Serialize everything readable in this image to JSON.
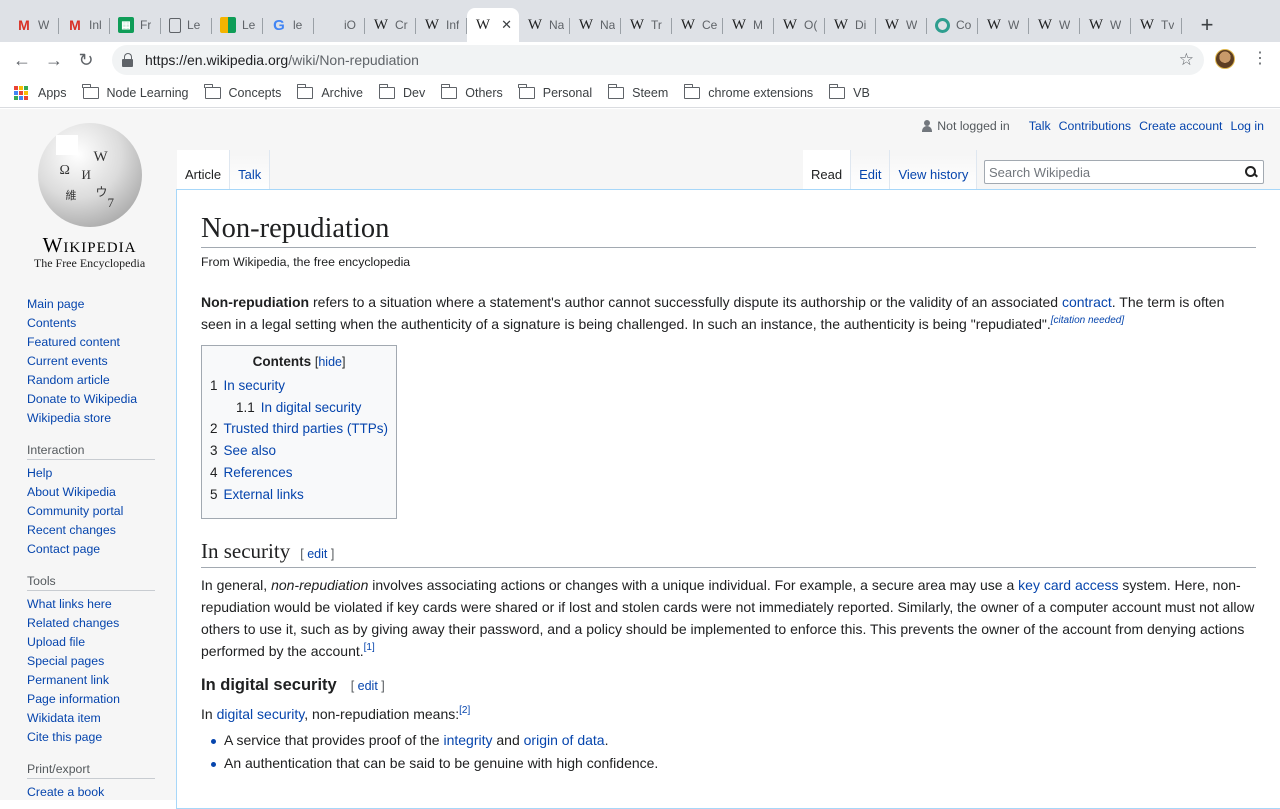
{
  "browser": {
    "tabs": [
      {
        "icon": "gmail-icon",
        "glyph": "M",
        "title": "W"
      },
      {
        "icon": "gmail-icon",
        "glyph": "M",
        "title": "Inl"
      },
      {
        "icon": "sheets-icon",
        "glyph": "▦",
        "title": "Fr"
      },
      {
        "icon": "document-icon",
        "glyph": "",
        "title": "Le"
      },
      {
        "icon": "slides-icon",
        "glyph": "",
        "title": "Le"
      },
      {
        "icon": "google-icon",
        "glyph": "G",
        "title": "le"
      },
      {
        "icon": "apple-icon",
        "glyph": "",
        "title": "iO"
      },
      {
        "icon": "wikipedia-icon",
        "glyph": "W",
        "title": "Cr"
      },
      {
        "icon": "wikipedia-icon",
        "glyph": "W",
        "title": "Inf"
      },
      {
        "icon": "wikipedia-icon",
        "glyph": "W",
        "title": "",
        "active": true
      },
      {
        "icon": "wikipedia-icon",
        "glyph": "W",
        "title": "Na"
      },
      {
        "icon": "wikipedia-icon",
        "glyph": "W",
        "title": "Na"
      },
      {
        "icon": "wikipedia-icon",
        "glyph": "W",
        "title": "Tr"
      },
      {
        "icon": "wikipedia-icon",
        "glyph": "W",
        "title": "Ce"
      },
      {
        "icon": "wikipedia-icon",
        "glyph": "W",
        "title": "M"
      },
      {
        "icon": "wikipedia-icon",
        "glyph": "W",
        "title": "O("
      },
      {
        "icon": "wikipedia-icon",
        "glyph": "W",
        "title": "Di"
      },
      {
        "icon": "wikipedia-icon",
        "glyph": "W",
        "title": "W"
      },
      {
        "icon": "globe-icon",
        "glyph": "",
        "title": "Co"
      },
      {
        "icon": "wikipedia-icon",
        "glyph": "W",
        "title": "W"
      },
      {
        "icon": "wikipedia-icon",
        "glyph": "W",
        "title": "W"
      },
      {
        "icon": "wikipedia-icon",
        "glyph": "W",
        "title": "W"
      },
      {
        "icon": "wikipedia-icon",
        "glyph": "W",
        "title": "Tv"
      }
    ],
    "close_glyph": "✕",
    "new_tab_glyph": "+",
    "back_glyph": "←",
    "forward_glyph": "→",
    "reload_glyph": "↻",
    "star_glyph": "☆",
    "menu_glyph": "⋮",
    "url_prefix": "https://en.wikipedia.org",
    "url_path": "/wiki/Non-repudiation",
    "bookmarks": [
      {
        "label": "Apps",
        "icon": "apps-grid-icon"
      },
      {
        "label": "Node Learning",
        "icon": "folder-icon"
      },
      {
        "label": "Concepts",
        "icon": "folder-icon"
      },
      {
        "label": "Archive",
        "icon": "folder-icon"
      },
      {
        "label": "Dev",
        "icon": "folder-icon"
      },
      {
        "label": "Others",
        "icon": "folder-icon"
      },
      {
        "label": "Personal",
        "icon": "folder-icon"
      },
      {
        "label": "Steem",
        "icon": "folder-icon"
      },
      {
        "label": "chrome extensions",
        "icon": "folder-icon"
      },
      {
        "label": "VB",
        "icon": "folder-icon"
      }
    ],
    "apps_colors": [
      "#ea4335",
      "#fbbc04",
      "#34a853",
      "#4285f4",
      "#ea4335",
      "#fbbc04",
      "#34a853",
      "#4285f4",
      "#ea4335"
    ]
  },
  "wiki": {
    "wordmark": "Wikipedia",
    "tagline": "The Free Encyclopedia",
    "globe_glyphs": [
      "Ω",
      "W",
      "И",
      "維",
      "ウ",
      "7"
    ],
    "personal": {
      "not_logged_in": "Not logged in",
      "links": [
        "Talk",
        "Contributions",
        "Create account",
        "Log in"
      ]
    },
    "namespaces": [
      "Article",
      "Talk"
    ],
    "views": [
      "Read",
      "Edit",
      "View history"
    ],
    "search_placeholder": "Search Wikipedia",
    "nav_main": [
      "Main page",
      "Contents",
      "Featured content",
      "Current events",
      "Random article",
      "Donate to Wikipedia",
      "Wikipedia store"
    ],
    "interaction_heading": "Interaction",
    "nav_interaction": [
      "Help",
      "About Wikipedia",
      "Community portal",
      "Recent changes",
      "Contact page"
    ],
    "tools_heading": "Tools",
    "nav_tools": [
      "What links here",
      "Related changes",
      "Upload file",
      "Special pages",
      "Permanent link",
      "Page information",
      "Wikidata item",
      "Cite this page"
    ],
    "print_heading": "Print/export",
    "nav_print": [
      "Create a book"
    ]
  },
  "article": {
    "title": "Non-repudiation",
    "site_sub": "From Wikipedia, the free encyclopedia",
    "lead_bold": "Non-repudiation",
    "lead_text_1": " refers to a situation where a statement's author cannot successfully dispute its authorship or the validity of an associated ",
    "lead_link": "contract",
    "lead_text_2": ". The term is often seen in a legal setting when the authenticity of a signature is being challenged. In such an instance, the authenticity is being \"repudiated\".",
    "lead_cite": "[citation needed]",
    "toc": {
      "title": "Contents",
      "hide": "hide",
      "items": [
        {
          "num": "1",
          "label": "In security"
        },
        {
          "num": "1.1",
          "label": "In digital security",
          "sub": true
        },
        {
          "num": "2",
          "label": "Trusted third parties (TTPs)"
        },
        {
          "num": "3",
          "label": "See also"
        },
        {
          "num": "4",
          "label": "References"
        },
        {
          "num": "5",
          "label": "External links"
        }
      ]
    },
    "edit_label": "edit",
    "section1": {
      "heading": "In security",
      "p_a": "In general, ",
      "p_em": "non-repudiation",
      "p_b": " involves associating actions or changes with a unique individual. For example, a secure area may use a ",
      "p_link": "key card access",
      "p_c": " system. Here, non-repudiation would be violated if key cards were shared or if lost and stolen cards were not immediately reported. Similarly, the owner of a computer account must not allow others to use it, such as by giving away their password, and a policy should be implemented to enforce this. This prevents the owner of the account from denying actions performed by the account.",
      "ref": "[1]"
    },
    "section2": {
      "heading": "In digital security",
      "p_a": "In ",
      "p_link": "digital security",
      "p_b": ", non-repudiation means:",
      "ref": "[2]",
      "bullet1_a": "A service that provides proof of the ",
      "bullet1_link1": "integrity",
      "bullet1_b": " and ",
      "bullet1_link2": "origin of data",
      "bullet1_c": ".",
      "bullet2": "An authentication that can be said to be genuine with high confidence."
    }
  }
}
